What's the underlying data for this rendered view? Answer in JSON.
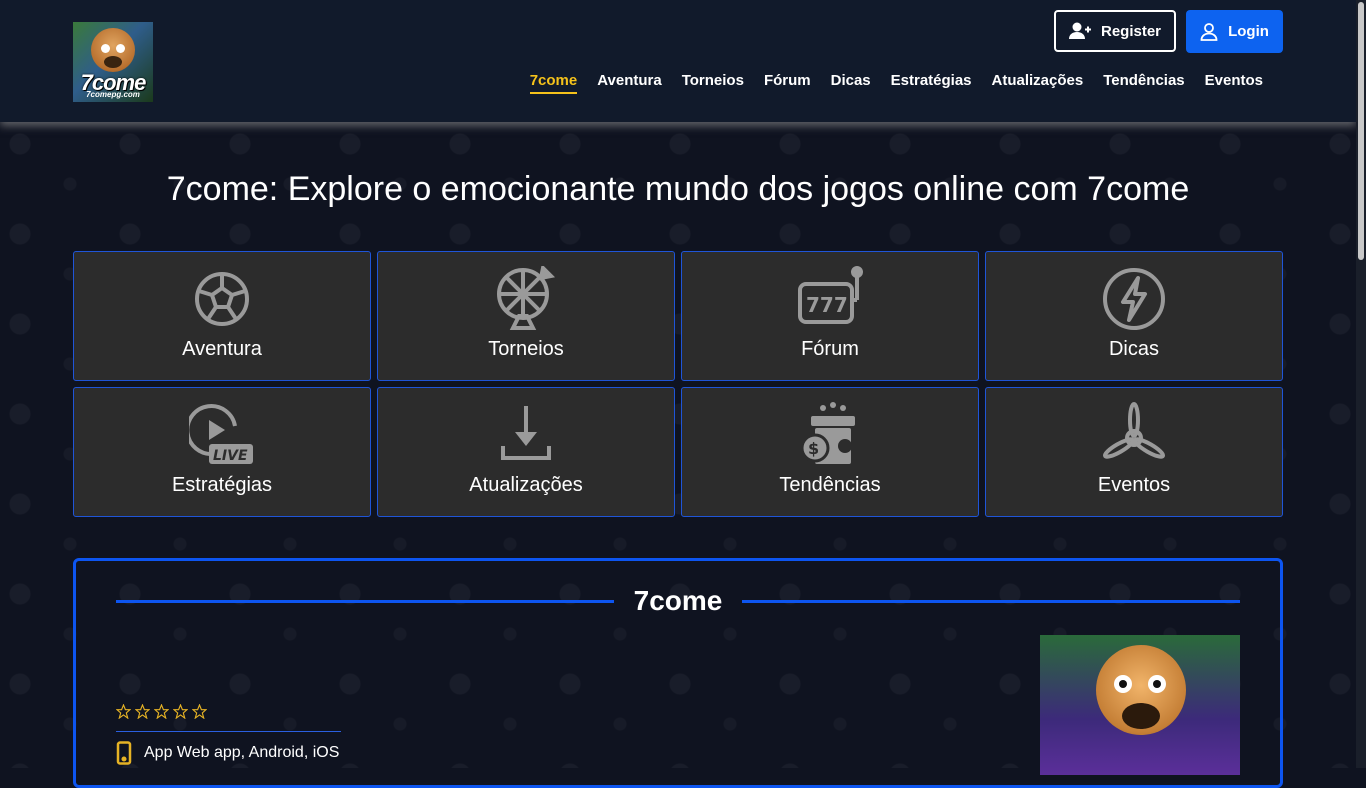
{
  "header": {
    "logo_text": "7come",
    "logo_sub": "7comepg.com",
    "register_label": "Register",
    "login_label": "Login",
    "nav": [
      {
        "label": "7come",
        "active": true
      },
      {
        "label": "Aventura"
      },
      {
        "label": "Torneios"
      },
      {
        "label": "Fórum"
      },
      {
        "label": "Dicas"
      },
      {
        "label": "Estratégias"
      },
      {
        "label": "Atualizações"
      },
      {
        "label": "Tendências"
      },
      {
        "label": "Eventos"
      }
    ]
  },
  "main": {
    "title": "7come: Explore o emocionante mundo dos jogos online com 7come",
    "cards": [
      {
        "label": "Aventura",
        "icon": "soccer-ball-icon"
      },
      {
        "label": "Torneios",
        "icon": "roulette-wheel-icon"
      },
      {
        "label": "Fórum",
        "icon": "slot-machine-icon"
      },
      {
        "label": "Dicas",
        "icon": "lightning-bolt-icon"
      },
      {
        "label": "Estratégias",
        "icon": "live-play-icon"
      },
      {
        "label": "Atualizações",
        "icon": "download-icon"
      },
      {
        "label": "Tendências",
        "icon": "gift-coins-icon"
      },
      {
        "label": "Eventos",
        "icon": "propeller-icon"
      }
    ]
  },
  "info": {
    "section_title": "7come",
    "rating": {
      "stars_total": 5,
      "stars_filled": 0
    },
    "app_text": "App Web app, Android, iOS"
  },
  "colors": {
    "accent_blue": "#0d63f0",
    "active_yellow": "#f5c21b",
    "card_bg": "#2c2c2c",
    "page_bg": "#0f1320"
  }
}
